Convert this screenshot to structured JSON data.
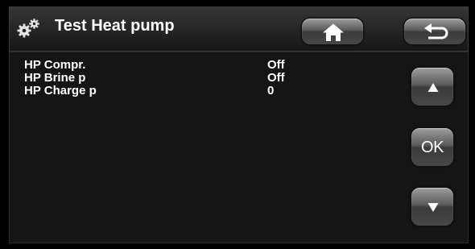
{
  "header": {
    "title": "Test Heat pump",
    "icon": "gears-icon"
  },
  "nav": {
    "home_icon": "home-icon",
    "back_icon": "back-arrow-icon",
    "up_icon": "triangle-up-icon",
    "down_icon": "triangle-down-icon",
    "ok_label": "OK"
  },
  "params": [
    {
      "name": "HP Compr.",
      "value": "Off"
    },
    {
      "name": "HP Brine p",
      "value": "Off"
    },
    {
      "name": "HP Charge p",
      "value": "0"
    }
  ],
  "colors": {
    "background": "#000000",
    "header": "#262626",
    "panel": "#151515",
    "button": "#5c5c5c",
    "text": "#ffffff"
  }
}
